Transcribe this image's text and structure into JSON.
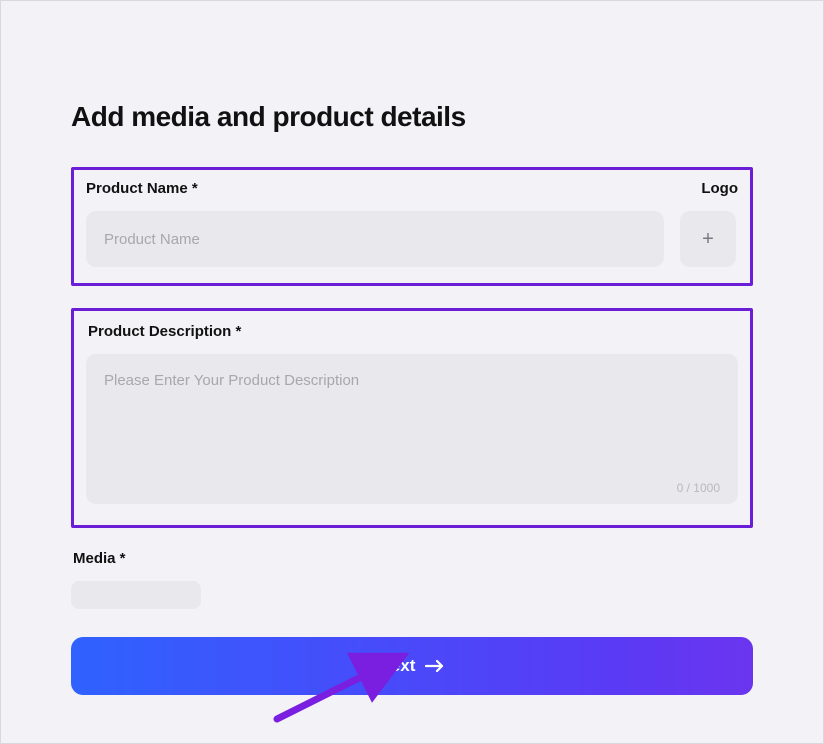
{
  "page_title": "Add media and product details",
  "product_name": {
    "label": "Product Name *",
    "placeholder": "Product Name",
    "value": ""
  },
  "logo": {
    "label": "Logo",
    "button": "+"
  },
  "product_description": {
    "label": "Product Description *",
    "placeholder": "Please Enter Your Product Description",
    "value": "",
    "counter": "0 / 1000"
  },
  "media": {
    "label": "Media *"
  },
  "next_button": "Next"
}
